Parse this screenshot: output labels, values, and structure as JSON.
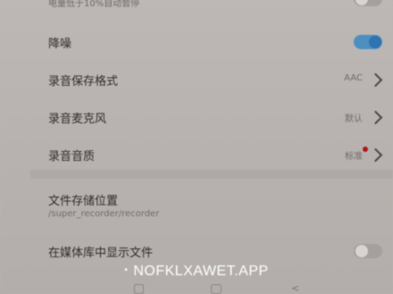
{
  "settings": {
    "top_note": "电量低于10%自动暂停",
    "noise_reduction": {
      "label": "降噪",
      "enabled": true
    },
    "recording_format": {
      "label": "录音保存格式",
      "value": "AAC"
    },
    "microphone": {
      "label": "录音麦克风",
      "value": "默认"
    },
    "quality": {
      "label": "录音音质",
      "value": "标准"
    },
    "storage_location": {
      "label": "文件存储位置",
      "path": "/super_recorder/recorder"
    },
    "show_in_media": {
      "label": "在媒体库中显示文件",
      "enabled": false
    }
  },
  "watermark": {
    "bullet": "•",
    "text": "NOFKLXAWET.APP"
  },
  "navbar": {
    "menu_icon": "menu-icon",
    "home_icon": "home-icon",
    "back_icon": "back-icon",
    "back_glyph": "<"
  },
  "colors": {
    "accent": "#2d74b0",
    "badge": "#b0161c",
    "background": "#b8b3b0"
  }
}
